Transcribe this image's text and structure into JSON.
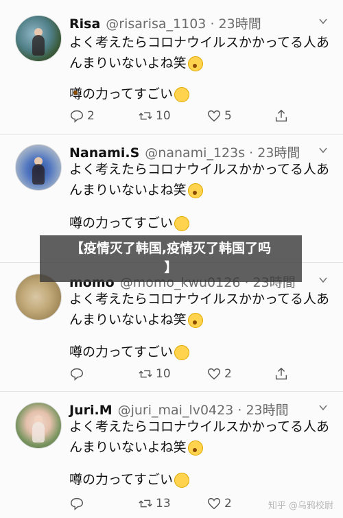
{
  "tweets": [
    {
      "name": "Risa",
      "handle": "@risarisa_1103 · 23時間",
      "text": "よく考えたらコロナウイルスかかってる人あんまりいないよね笑",
      "sub": "噂の力ってすごい",
      "reply_count": "2",
      "retweet_count": "10",
      "like_count": "5"
    },
    {
      "name": "Nanami.S",
      "handle": "@nanami_123s · 23時間",
      "text": "よく考えたらコロナウイルスかかってる人あんまりいないよね笑",
      "sub": "噂の力ってすごい"
    },
    {
      "name": "momo",
      "handle": "@momo_kwu0126 · 23時間",
      "text": "よく考えたらコロナウイルスかかってる人あんまりいないよね笑",
      "sub": "噂の力ってすごい",
      "reply_count": "",
      "retweet_count": "10",
      "like_count": "2"
    },
    {
      "name": "Juri.M",
      "handle": "@juri_mai_lv0423 · 23時間",
      "text": "よく考えたらコロナウイルスかかってる人あんまりいないよね笑",
      "sub": "噂の力ってすごい",
      "reply_count": "",
      "retweet_count": "13",
      "like_count": "2"
    }
  ],
  "banner": {
    "line1": "【疫情灭了韩国,疫情灭了韩国了吗",
    "line2": "】"
  },
  "watermark": "知乎 @乌鸦校尉",
  "colors": {
    "like": "#555555",
    "banner_bg": "#3c3c3c"
  }
}
